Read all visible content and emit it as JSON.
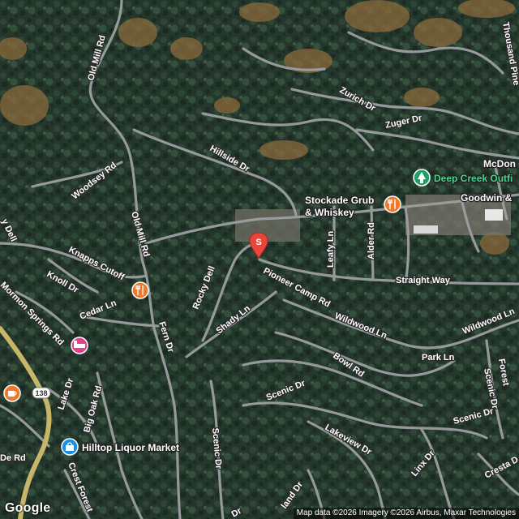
{
  "map": {
    "type": "satellite",
    "colors": {
      "road": "#9d9fa0",
      "highway": "#c7b56a",
      "forest": "#24372c",
      "dry": "#8a6a3c",
      "food": "#f0782a",
      "hotel": "#e43f8c",
      "shop": "#1a8fe3",
      "park": "#1f9e6a",
      "pin": "#e8453c"
    }
  },
  "roads": {
    "old_mill_rd_north": "Old Mill Rd",
    "old_mill_rd_south": "Old Mill Rd",
    "woodsey_rd": "Woodsey Rd",
    "hillside_dr": "Hillside Dr",
    "zurich_dr": "Zurich Dr",
    "zuger_dr": "Zuger Dr",
    "knapps_cutoff": "Knapps Cutoff",
    "knoll_dr": "Knoll Dr",
    "cedar_ln": "Cedar Ln",
    "mormon_springs_rd": "Mormon Springs Rd",
    "rocky_dell": "Rocky Dell",
    "dell_west": "y Dell",
    "fern_dr": "Fern Dr",
    "shady_ln": "Shady Ln",
    "pioneer_camp_rd": "Pioneer Camp Rd",
    "leafy_ln": "Leafy Ln",
    "alder_rd": "Alder Rd",
    "straight_way": "Straight Way",
    "wildwood_ln_center": "Wildwood Ln",
    "wildwood_ln_east": "Wildwood Ln",
    "park_ln": "Park Ln",
    "bowl_rd": "Bowl Rd",
    "scenic_dr_center": "Scenic Dr",
    "scenic_dr_west": "Scenic Dr",
    "scenic_dr_east": "Scenic Dr",
    "scenic_dr_vertical": "Scenic Dr",
    "lakeview_dr": "Lakeview Dr",
    "linx_dr": "Linx Dr",
    "cresta_dr": "Cresta D",
    "big_oak_rd": "Big Oak Rd",
    "lake_dr": "Lake Dr",
    "crest_forest": "Crest Forest",
    "thousand_pines": "Thousand Pine",
    "de_rd": "De Rd",
    "forest_east": "Forest",
    "land_dr": "land Dr",
    "dr_bottom": "Dr",
    "route_138": "138"
  },
  "pois": {
    "deep_creek": "Deep Creek Outfi",
    "stockade_line1": "Stockade Grub",
    "stockade_line2": "& Whiskey",
    "hilltop_liquor": "Hilltop Liquor Market",
    "mcdon": "McDon",
    "goodwin": "Goodwin &",
    "selected_pin": "S"
  },
  "icons": [
    "fork-knife-icon",
    "coffee-cup-icon",
    "hotel-bed-icon",
    "shopping-bag-icon",
    "tree-icon",
    "location-pin-icon"
  ],
  "footer": {
    "logo": "Google",
    "attribution": "Map data ©2026 Imagery ©2026 Airbus, Maxar Technologies"
  }
}
